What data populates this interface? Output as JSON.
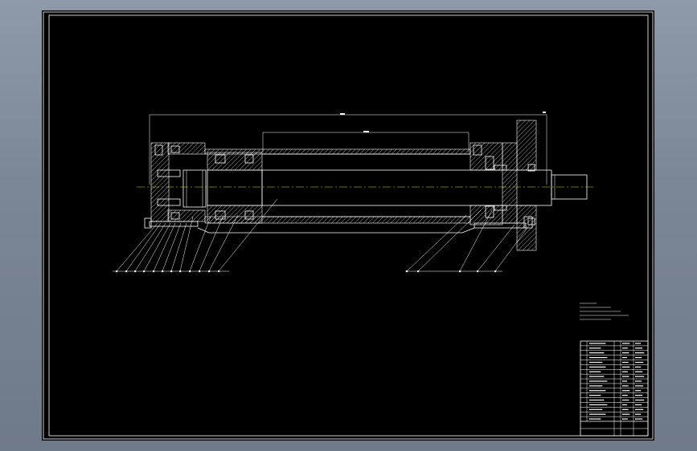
{
  "colors": {
    "sheet": "#000000",
    "line": "#ffffff",
    "centerline": "#d7e84a",
    "chrome": "#7c8796"
  },
  "icons": [
    "drawing-border",
    "cylinder-section",
    "title-block"
  ],
  "drawing": {
    "balloon_count_left": 12,
    "balloon_count_right": 5,
    "bom_rows": 17
  }
}
